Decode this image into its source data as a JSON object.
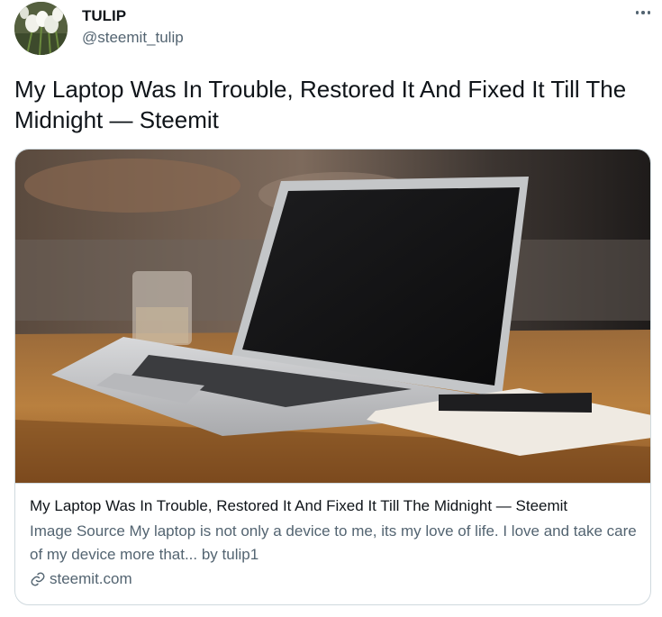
{
  "author": {
    "name": "TULIP",
    "handle": "@steemit_tulip"
  },
  "tweet": {
    "text": "My Laptop Was In Trouble, Restored It And Fixed It Till The Midnight — Steemit"
  },
  "card": {
    "title": "My Laptop Was In Trouble, Restored It And Fixed It Till The Midnight — Steemit",
    "description": "Image Source My laptop is not only a device to me, its my love of life. I love and take care of my device more that... by tulip1",
    "domain": "steemit.com",
    "image_icon": "laptop-photo"
  },
  "colors": {
    "text_primary": "#0f1419",
    "text_secondary": "#536471",
    "border": "#cfd9de"
  }
}
